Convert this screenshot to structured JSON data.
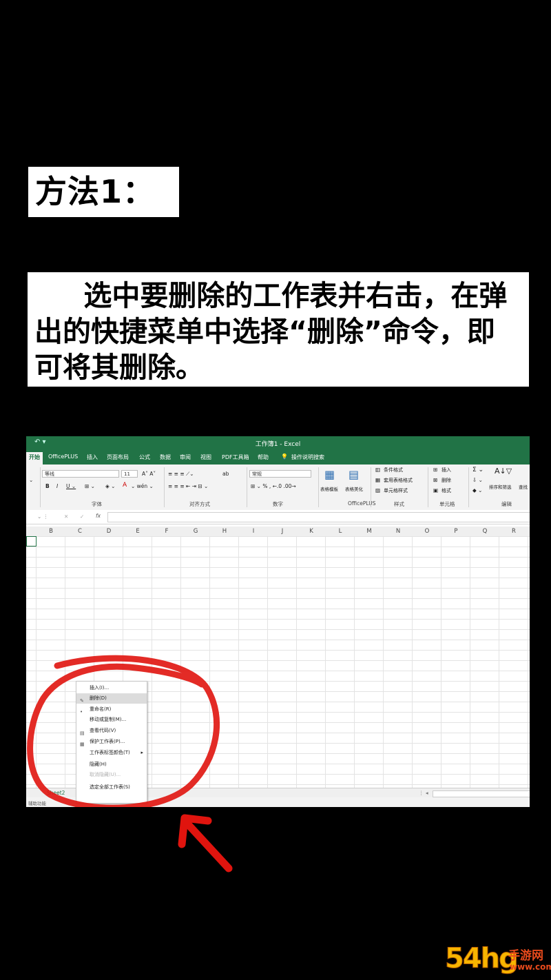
{
  "method_title": "方法1：",
  "instruction": "     选中要删除的工作表并右击，在弹出的快捷菜单中选择“删除”命令，即可将其删除。",
  "excel": {
    "window_title": "工作簿1 - Excel",
    "tabs": [
      "开始",
      "OfficePLUS",
      "插入",
      "页面布局",
      "公式",
      "数据",
      "审阅",
      "视图",
      "PDF工具箱",
      "帮助",
      "操作说明搜索"
    ],
    "ribbon": {
      "font_name": "等线",
      "font_size": "11",
      "number_format": "常规",
      "group_font": "字体",
      "group_align": "对齐方式",
      "group_number": "数字",
      "group_officeplus": "OfficePLUS",
      "group_styles": "样式",
      "group_cells": "单元格",
      "group_edit": "编辑",
      "table_template": "表格模板",
      "table_beautify": "表格美化",
      "cond_format": "条件格式",
      "table_format": "套用表格格式",
      "cell_style": "单元格样式",
      "insert": "插入",
      "delete": "删除",
      "format": "格式",
      "sort_filter": "排序和筛选",
      "find": "查找"
    },
    "fx": "fx",
    "columns": [
      "B",
      "C",
      "D",
      "E",
      "F",
      "G",
      "H",
      "I",
      "J",
      "K",
      "L",
      "M",
      "N",
      "O",
      "P",
      "Q",
      "R"
    ],
    "sheet_tab": "Sheet2",
    "status_text": "辅助功能",
    "context_menu": [
      "插入(I)...",
      "删除(D)",
      "重命名(R)",
      "移动或复制(M)...",
      "查看代码(V)",
      "保护工作表(P)...",
      "工作表标签颜色(T)",
      "隐藏(H)",
      "取消隐藏(U)...",
      "选定全部工作表(S)"
    ]
  },
  "watermark": {
    "logo": "54hg",
    "name": "手游网",
    "domain": "www.com.cn"
  },
  "colors": {
    "background": "#000000",
    "excel_green": "#217346",
    "annotation_red": "#e0140e"
  }
}
